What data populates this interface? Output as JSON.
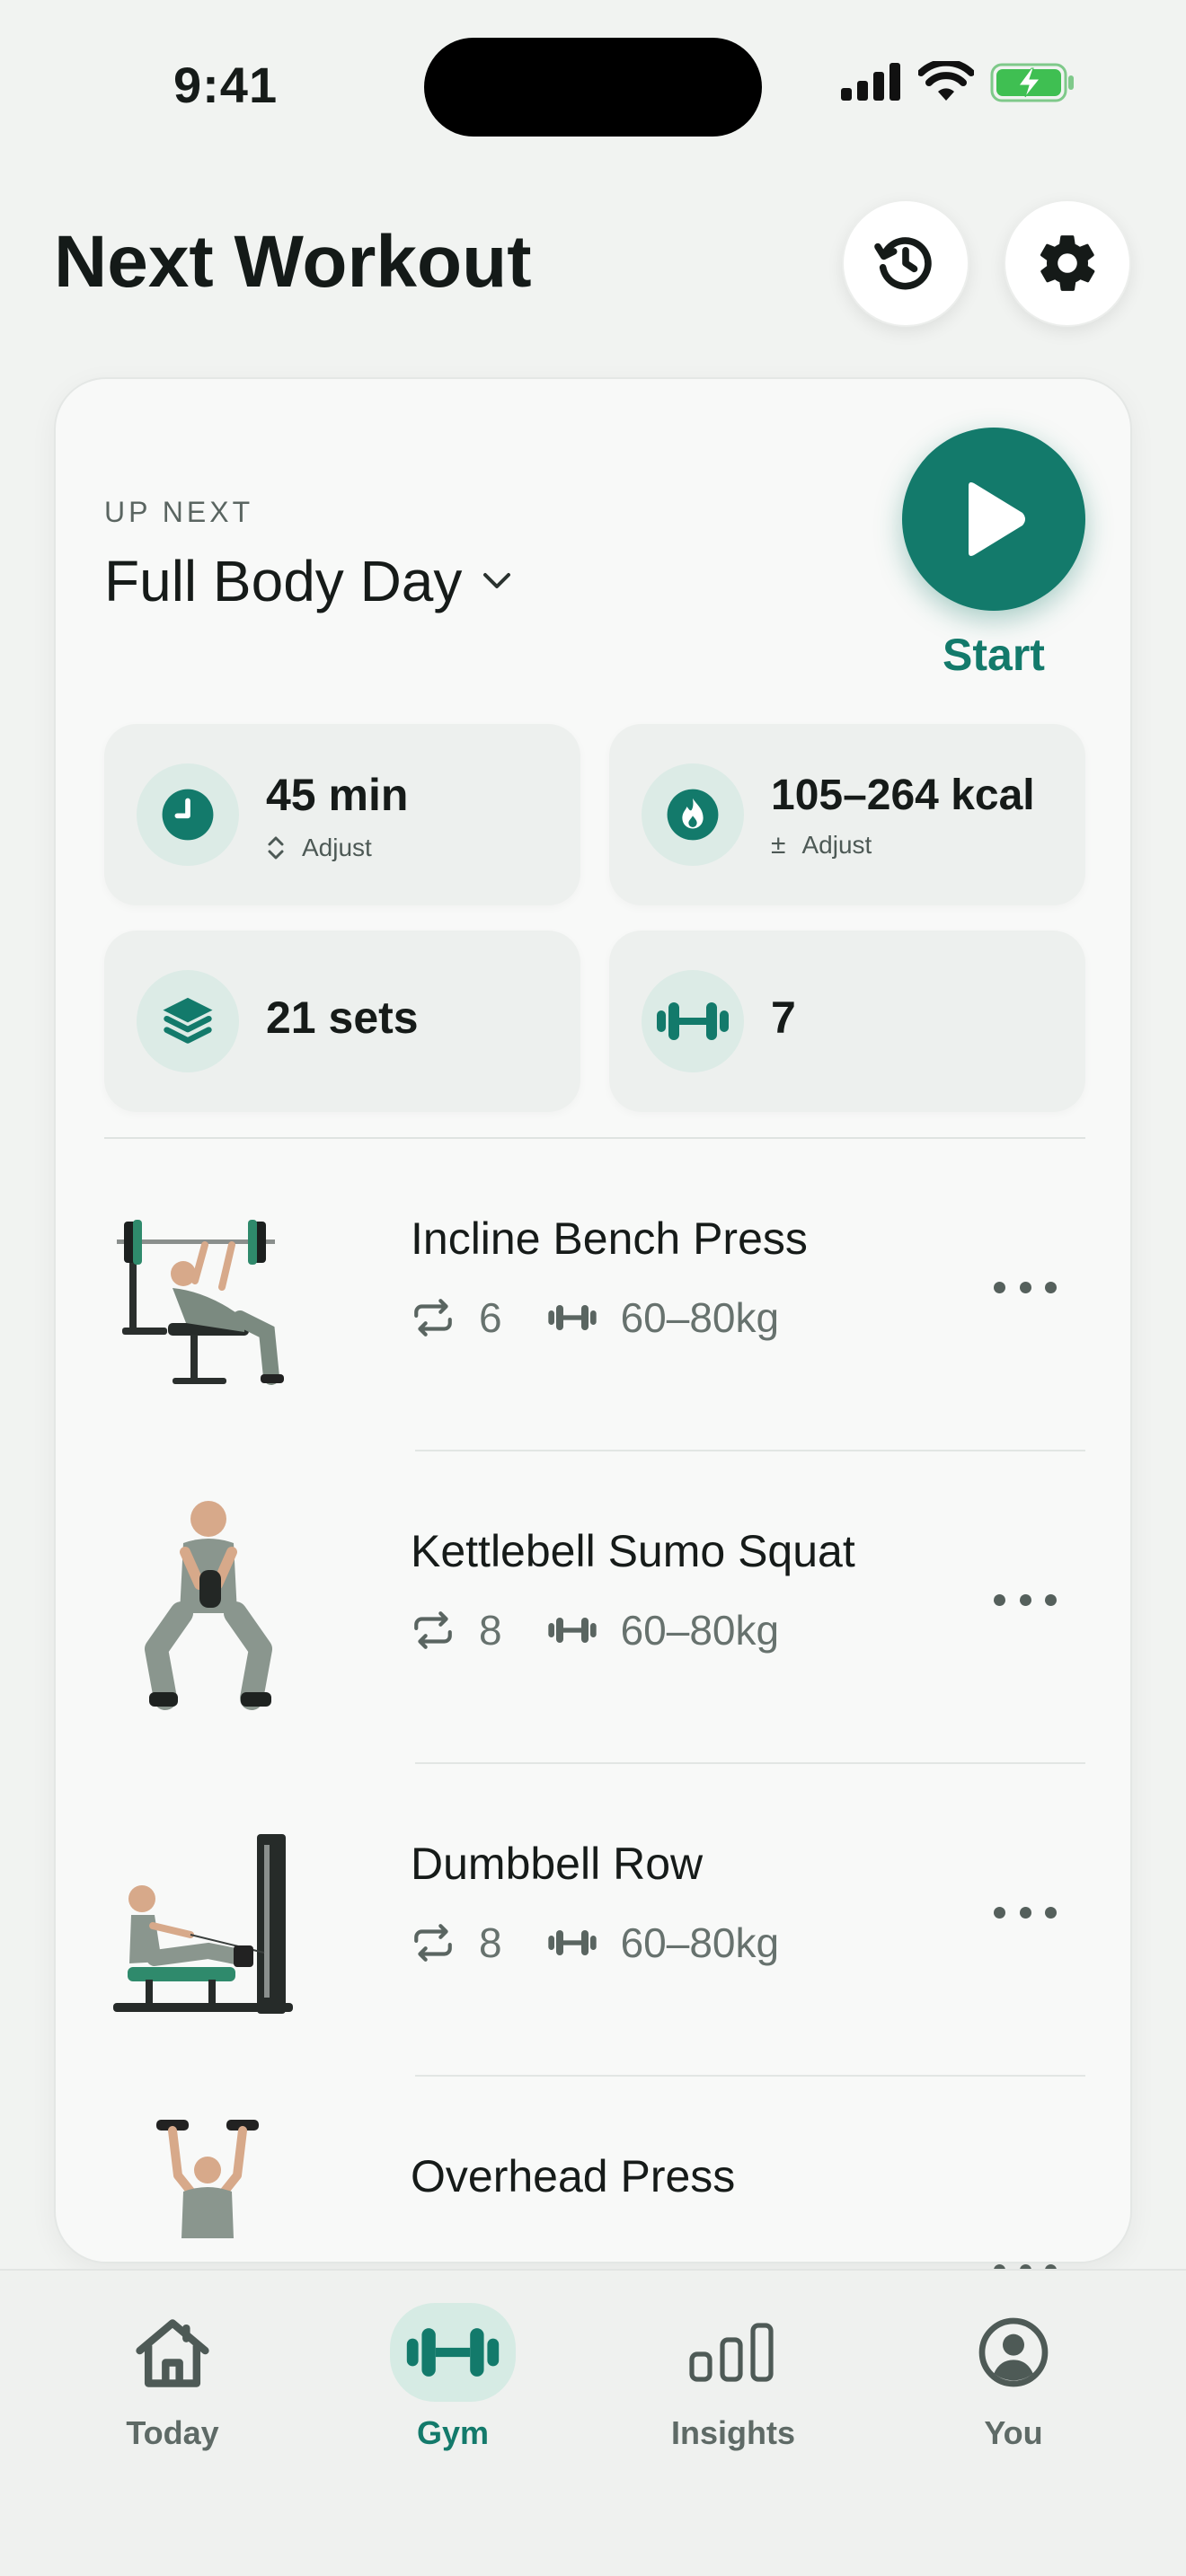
{
  "status": {
    "time": "9:41"
  },
  "header": {
    "title": "Next Workout",
    "history_icon": "history-icon",
    "settings_icon": "gear-icon"
  },
  "workout": {
    "eyebrow": "UP NEXT",
    "name": "Full Body Day",
    "start_label": "Start",
    "stats": {
      "duration": "45 min",
      "duration_action": "Adjust",
      "calories": "105–264 kcal",
      "calories_action": "Adjust",
      "sets": "21 sets",
      "exercises": "7"
    },
    "exercises": [
      {
        "name": "Incline Bench Press",
        "reps": "6",
        "weight": "60–80kg"
      },
      {
        "name": "Kettlebell Sumo Squat",
        "reps": "8",
        "weight": "60–80kg"
      },
      {
        "name": "Dumbbell Row",
        "reps": "8",
        "weight": "60–80kg"
      },
      {
        "name": "Overhead Press"
      }
    ]
  },
  "tabs": [
    {
      "label": "Today",
      "icon": "home-icon"
    },
    {
      "label": "Gym",
      "icon": "dumbbell-icon",
      "active": true
    },
    {
      "label": "Insights",
      "icon": "bar-chart-icon"
    },
    {
      "label": "You",
      "icon": "profile-icon"
    }
  ],
  "colors": {
    "accent": "#137a6b",
    "accent_soft": "#dcebe6",
    "background": "#f1f3f1"
  }
}
